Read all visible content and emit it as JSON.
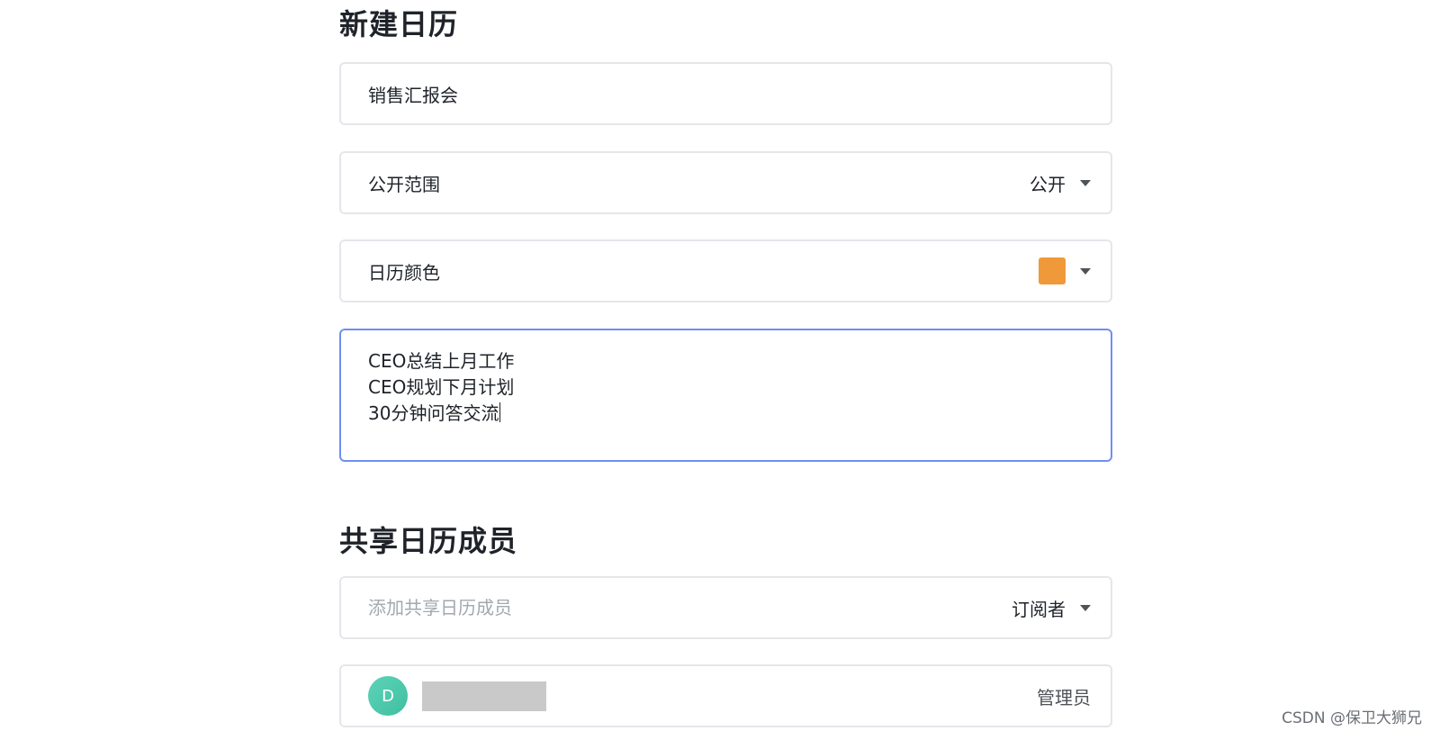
{
  "form": {
    "title": "新建日历",
    "name_value": "销售汇报会",
    "visibility": {
      "label": "公开范围",
      "value": "公开",
      "icon": "chevron-down-icon"
    },
    "color": {
      "label": "日历颜色",
      "swatch": "#f0993a",
      "icon": "chevron-down-icon"
    },
    "description_lines": [
      "CEO总结上月工作",
      "CEO规划下月计划",
      "30分钟问答交流"
    ]
  },
  "sharing": {
    "title": "共享日历成员",
    "add_placeholder": "添加共享日历成员",
    "role_select": "订阅者",
    "member": {
      "avatar_initial": "D",
      "avatar_color": "#4cc9a9",
      "role": "管理员"
    }
  },
  "watermark": "CSDN @保卫大狮兄"
}
